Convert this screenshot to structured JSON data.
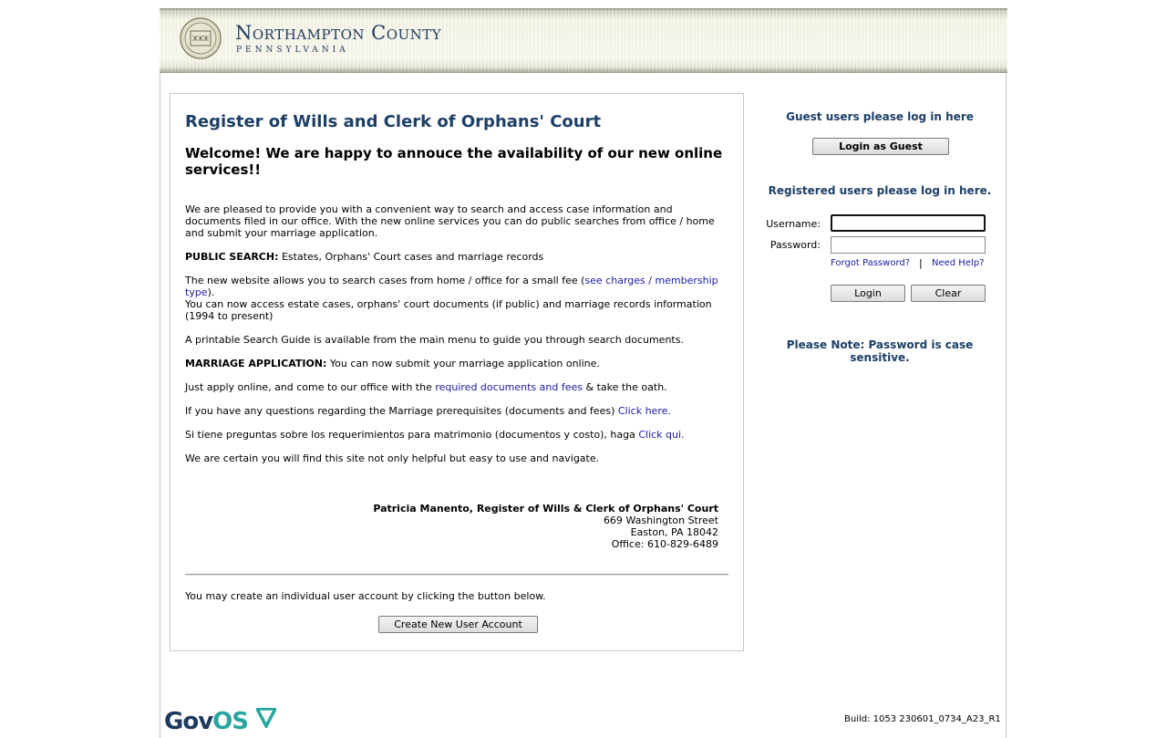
{
  "header": {
    "county_name": "Northampton County",
    "state_name": "PENNSYLVANIA"
  },
  "main": {
    "office_title": "Register of Wills and Clerk of Orphans' Court",
    "welcome": "Welcome! We are happy to annouce the availability of our new online services!!",
    "intro": "We are pleased to provide you with a convenient way to search and access case information and documents filed in our office. With the new online services you can do public searches from office / home and submit your marriage application.",
    "public_search_label": "PUBLIC SEARCH:",
    "public_search_text": " Estates, Orphans' Court cases and marriage records",
    "fee_text": "The new website allows you to search cases from home / office for a small fee (",
    "fee_link": "see charges / membership type",
    "fee_end": ").",
    "access_text": "You can now access estate cases, orphans' court documents (if public) and marriage records information (1994 to present)",
    "guide_text": "A printable Search Guide is available from the main menu to guide you through search documents.",
    "marriage_label": "MARRIAGE APPLICATION:",
    "marriage_text": " You can now submit your marriage application online.",
    "apply_text": "Just apply online, and come to our office with the ",
    "apply_link": "required documents and fees",
    "apply_end": " & take the oath.",
    "questions_text": "If you have any questions regarding the Marriage prerequisites (documents and fees) ",
    "questions_link": "Click here.",
    "spanish_text": "Si tiene preguntas sobre los requerimientos para matrimonio (documentos y costo), haga ",
    "spanish_link": "Click qui.",
    "closing_text": "We are certain you will find this site not only helpful but easy to use and navigate.",
    "signature": {
      "name": "Patricia Manento, Register of Wills & Clerk of Orphans' Court",
      "street": "669 Washington Street",
      "city": "Easton, PA 18042",
      "phone": "Office: 610-829-6489"
    },
    "create_note": "You may create an individual user account by clicking the button below.",
    "create_button": "Create New User Account"
  },
  "login": {
    "guest_heading": "Guest users please log in here",
    "guest_button": "Login as Guest",
    "registered_heading": "Registered users please log in here.",
    "username_label": "Username:",
    "username_value": "",
    "password_label": "Password:",
    "password_value": "",
    "forgot_link": "Forgot Password?",
    "separator": "|",
    "help_link": "Need Help?",
    "login_button": "Login",
    "clear_button": "Clear",
    "note": "Please Note: Password is case sensitive."
  },
  "footer": {
    "logo_gov": "Gov",
    "logo_os": "OS",
    "build": "Build: 1053 230601_0734_A23_R1"
  },
  "colors": {
    "heading_blue": "#1d3f66",
    "link_blue": "#1a1aa6",
    "govos_teal": "#2aa6a0"
  }
}
